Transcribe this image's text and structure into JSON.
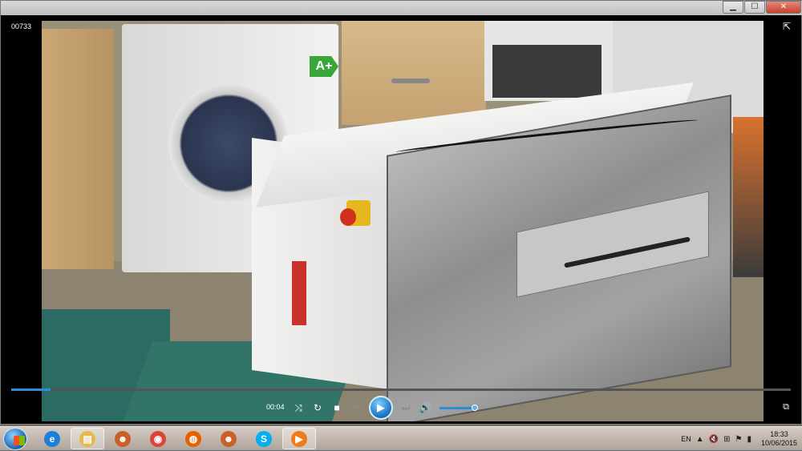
{
  "window": {
    "title": "",
    "controls": {
      "minimize": "▁",
      "maximize": "☐",
      "close": "✕"
    }
  },
  "player": {
    "top_label": "00733",
    "current_time": "00:04",
    "progress_fraction": 0.05,
    "volume_fraction": 0.95
  },
  "video_scene": {
    "energy_label": "A+"
  },
  "taskbar": {
    "items": [
      {
        "name": "internet-explorer",
        "glyph": "e",
        "color": "#1e7fd6",
        "active": false
      },
      {
        "name": "file-explorer",
        "glyph": "▤",
        "color": "#e7b84a",
        "active": true
      },
      {
        "name": "app-wolf",
        "glyph": "☻",
        "color": "#c8602a",
        "active": false
      },
      {
        "name": "chrome",
        "glyph": "◉",
        "color": "#db4437",
        "active": false
      },
      {
        "name": "firefox",
        "glyph": "◍",
        "color": "#e66000",
        "active": false
      },
      {
        "name": "app-wolf-2",
        "glyph": "☻",
        "color": "#c8602a",
        "active": false
      },
      {
        "name": "skype",
        "glyph": "S",
        "color": "#00aff0",
        "active": false
      },
      {
        "name": "media-player",
        "glyph": "▶",
        "color": "#f07a1a",
        "active": true
      }
    ],
    "language": "EN",
    "time": "18:33",
    "date": "10/06/2015"
  }
}
